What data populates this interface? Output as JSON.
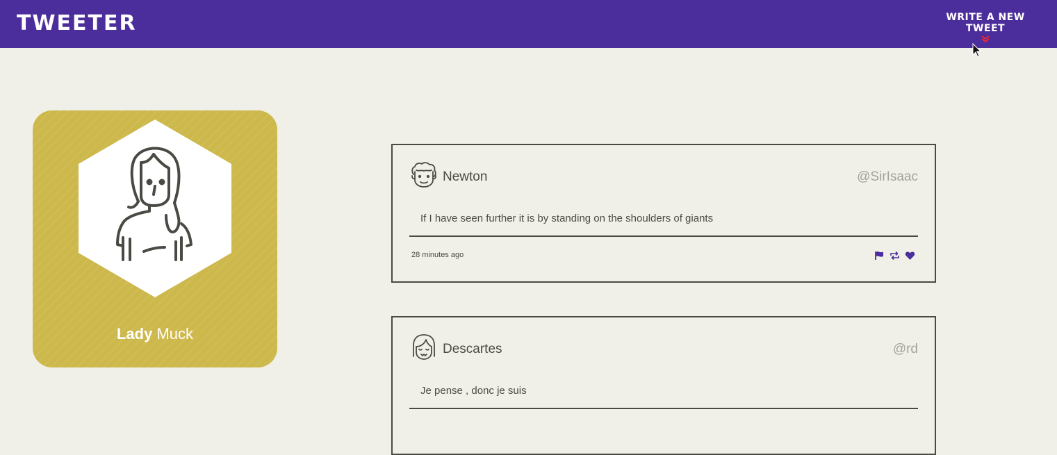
{
  "navbar": {
    "brand": "TWEETER",
    "compose_label": "WRITE A NEW TWEET",
    "compose_icon": "double-chevron-down-icon",
    "compose_icon_color": "#e8283c",
    "background_color": "#4b2d9b"
  },
  "profile": {
    "first_name": "Lady",
    "last_name": "Muck",
    "card_color": "#cdb84b",
    "avatar_icon": "woman-avatar-icon"
  },
  "tweets": [
    {
      "name": "Newton",
      "handle": "@SirIsaac",
      "content": "If I have seen further it is by standing on the shoulders of giants",
      "time": "28 minutes ago",
      "avatar_icon": "curly-hair-avatar-icon",
      "actions": [
        "flag-icon",
        "retweet-icon",
        "heart-icon"
      ]
    },
    {
      "name": "Descartes",
      "handle": "@rd",
      "content": "Je pense , donc je suis",
      "avatar_icon": "bob-hair-avatar-icon"
    }
  ],
  "accent_color": "#4b2d9b"
}
